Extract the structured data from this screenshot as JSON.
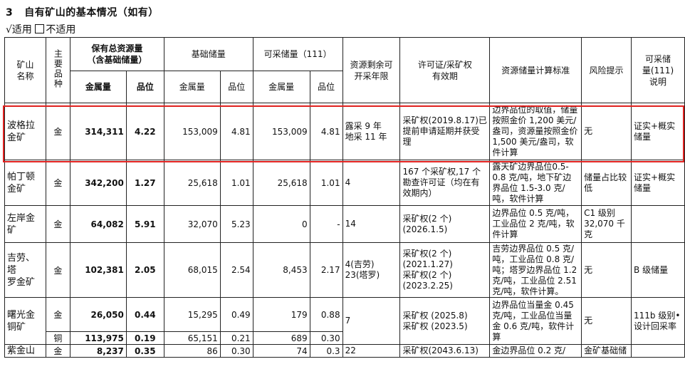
{
  "section": {
    "number": "3",
    "title": "自有矿山的基本情况（如有）"
  },
  "applicability": {
    "checked_mark": "√",
    "checked": "适用",
    "unchecked": "不适用"
  },
  "headers": {
    "mine": "矿山\n名称",
    "mineral": "主要品种",
    "total": "保有总资源量\n（含基础储量）",
    "basic": "基础储量",
    "recoverable": "可采储量（111）",
    "remaining": "资源剩余可\n开采年限",
    "permit": "许可证/采矿权\n有效期",
    "standard": "资源储量计算标准",
    "risk": "风险提示",
    "note": "可采储\n量(111)\n说明",
    "metal": "金属量",
    "grade": "品位"
  },
  "rows": [
    {
      "mine": "波格拉\n金矿",
      "mineral": "金",
      "total_metal": "314,311",
      "total_grade": "4.22",
      "basic_metal": "153,009",
      "basic_grade": "4.81",
      "rec_metal": "153,009",
      "rec_grade": "4.81",
      "remaining": "露采 9 年\n地采 11 年",
      "permit": "采矿权(2019.8.17)已提前申请延期并获受理",
      "standard": "边界品位的取值，储量按照金价 1,200 美元/盎司，资源量按照金价1,500 美元/盎司，软件计算",
      "risk": "无",
      "note": "证实+概实储量"
    },
    {
      "mine": "帕丁顿\n金矿",
      "mineral": "金",
      "total_metal": "342,200",
      "total_grade": "1.27",
      "basic_metal": "25,618",
      "basic_grade": "1.01",
      "rec_metal": "25,618",
      "rec_grade": "1.01",
      "remaining": "4",
      "permit": "167 个采矿权,17 个勘查许可证（均在有效期内）",
      "standard": "露天矿边界品位0.5-0.8 克/吨，地下矿边界品位 1.5-3.0 克/吨，软件计算",
      "risk": "储量占比较低",
      "note": "证实+概实储量"
    },
    {
      "mine": "左岸金\n矿",
      "mineral": "金",
      "total_metal": "64,082",
      "total_grade": "5.91",
      "basic_metal": "32,070",
      "basic_grade": "5.23",
      "rec_metal": "0",
      "rec_grade": "-",
      "remaining": "14",
      "permit": "采矿权(2 个)\n(2026.1.5)",
      "standard": "边界品位 0.5 克/吨，工业品位 2 克/吨，软件计算",
      "risk": "C1 级别32,070 千克",
      "note": ""
    },
    {
      "mine": "吉劳、塔\n罗金矿",
      "mineral": "金",
      "total_metal": "102,381",
      "total_grade": "2.05",
      "basic_metal": "68,015",
      "basic_grade": "2.54",
      "rec_metal": "8,453",
      "rec_grade": "2.17",
      "remaining": "4(吉劳)\n23(塔罗)",
      "permit": "采矿权(2 个)\n(2021.1.27)\n采矿权(2 个)\n(2023.2.25)",
      "standard": "吉劳边界品位 0.5 克/吨，工业品位 0.8 克/吨；塔罗边界品位 1.2 克/吨，工业品位 2.51 克/吨，软件计算。",
      "risk": "无",
      "note": "B 级储量"
    },
    {
      "mine": "曙光金\n铜矿",
      "mineral": "金",
      "total_metal": "26,050",
      "total_grade": "0.44",
      "basic_metal": "15,295",
      "basic_grade": "0.49",
      "rec_metal": "179",
      "rec_grade": "0.88",
      "remaining": "7",
      "permit": "采矿权 (2025.8)\n采矿权 (2023.5)",
      "standard": "边界品位当量金 0.45 克/吨，工业品位当量金 0.6 克/吨，软件计算",
      "risk": "无",
      "note": "111b 级别•设计回采率"
    },
    {
      "mine": "",
      "mineral": "铜",
      "total_metal": "113,975",
      "total_grade": "0.19",
      "basic_metal": "65,151",
      "basic_grade": "0.21",
      "rec_metal": "689",
      "rec_grade": "0.30"
    },
    {
      "mine": "紫金山",
      "mineral": "金",
      "total_metal": "8,237",
      "total_grade": "0.35",
      "basic_metal": "86",
      "basic_grade": "0.30",
      "rec_metal": "74",
      "rec_grade": "0.3",
      "remaining": "22",
      "permit": "采矿权(2043.6.13)",
      "standard": "金边界品位 0.2 克/",
      "risk": "金矿基础储",
      "note": ""
    }
  ]
}
